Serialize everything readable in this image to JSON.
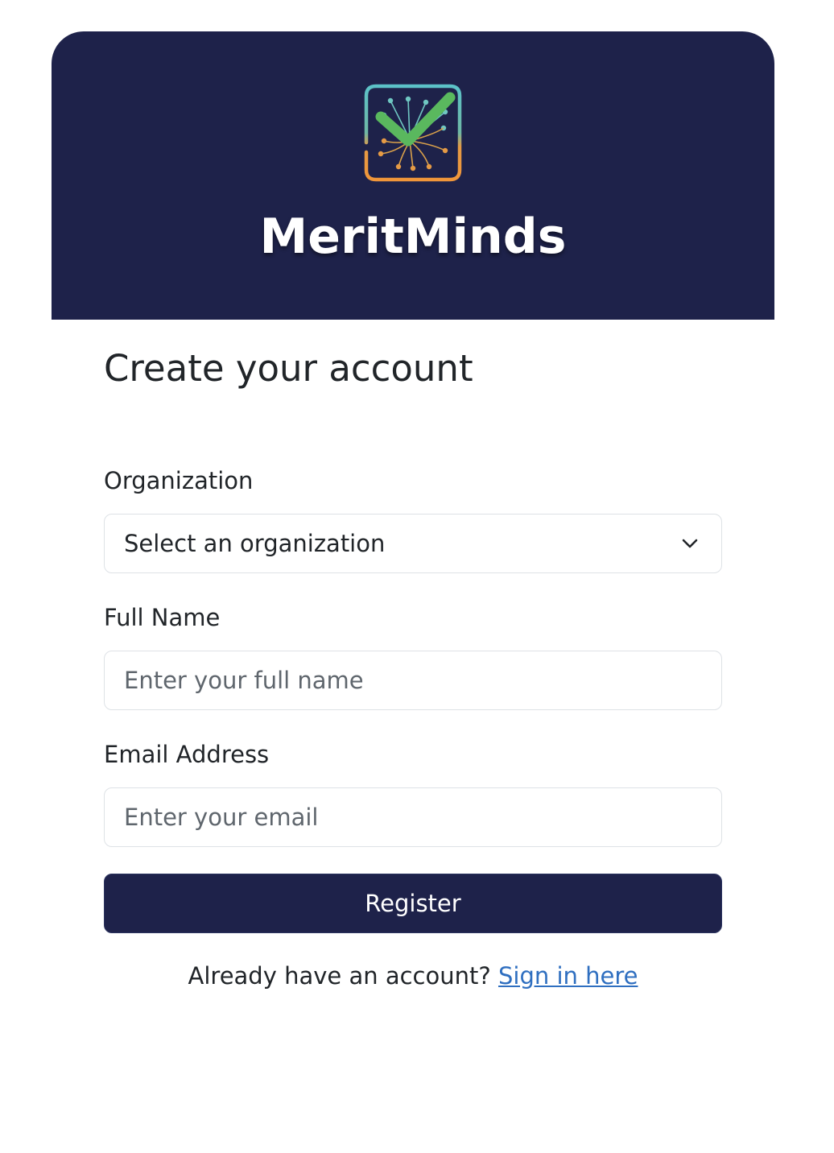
{
  "brand": {
    "name": "MeritMinds",
    "logo_icon": "checkmark-network-icon",
    "header_color": "#1e224a"
  },
  "form": {
    "title": "Create your account",
    "organization": {
      "label": "Organization",
      "selected": "Select an organization",
      "icon": "chevron-down-icon"
    },
    "full_name": {
      "label": "Full Name",
      "placeholder": "Enter your full name",
      "value": ""
    },
    "email": {
      "label": "Email Address",
      "placeholder": "Enter your email",
      "value": ""
    },
    "register_label": "Register"
  },
  "footer": {
    "prompt": "Already have an account?",
    "link_label": "Sign in here",
    "link_color": "#2f6fc0"
  }
}
